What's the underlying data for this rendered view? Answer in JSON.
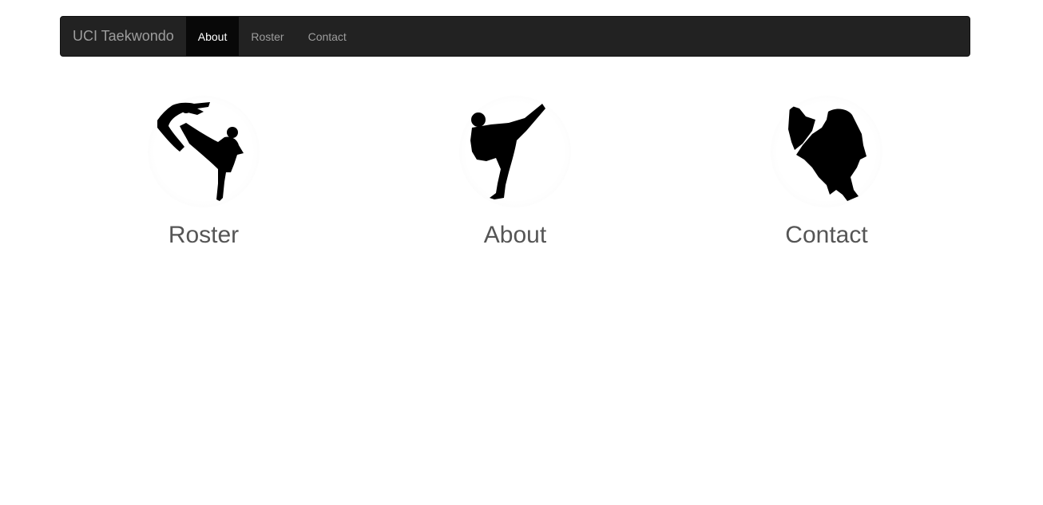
{
  "navbar": {
    "brand": "UCI Taekwondo",
    "items": [
      {
        "label": "About",
        "active": true
      },
      {
        "label": "Roster",
        "active": false
      },
      {
        "label": "Contact",
        "active": false
      }
    ]
  },
  "cards": [
    {
      "title": "Roster",
      "icon": "jump-kick-silhouette-icon"
    },
    {
      "title": "About",
      "icon": "high-kick-silhouette-icon"
    },
    {
      "title": "Contact",
      "icon": "side-kick-silhouette-icon"
    }
  ]
}
